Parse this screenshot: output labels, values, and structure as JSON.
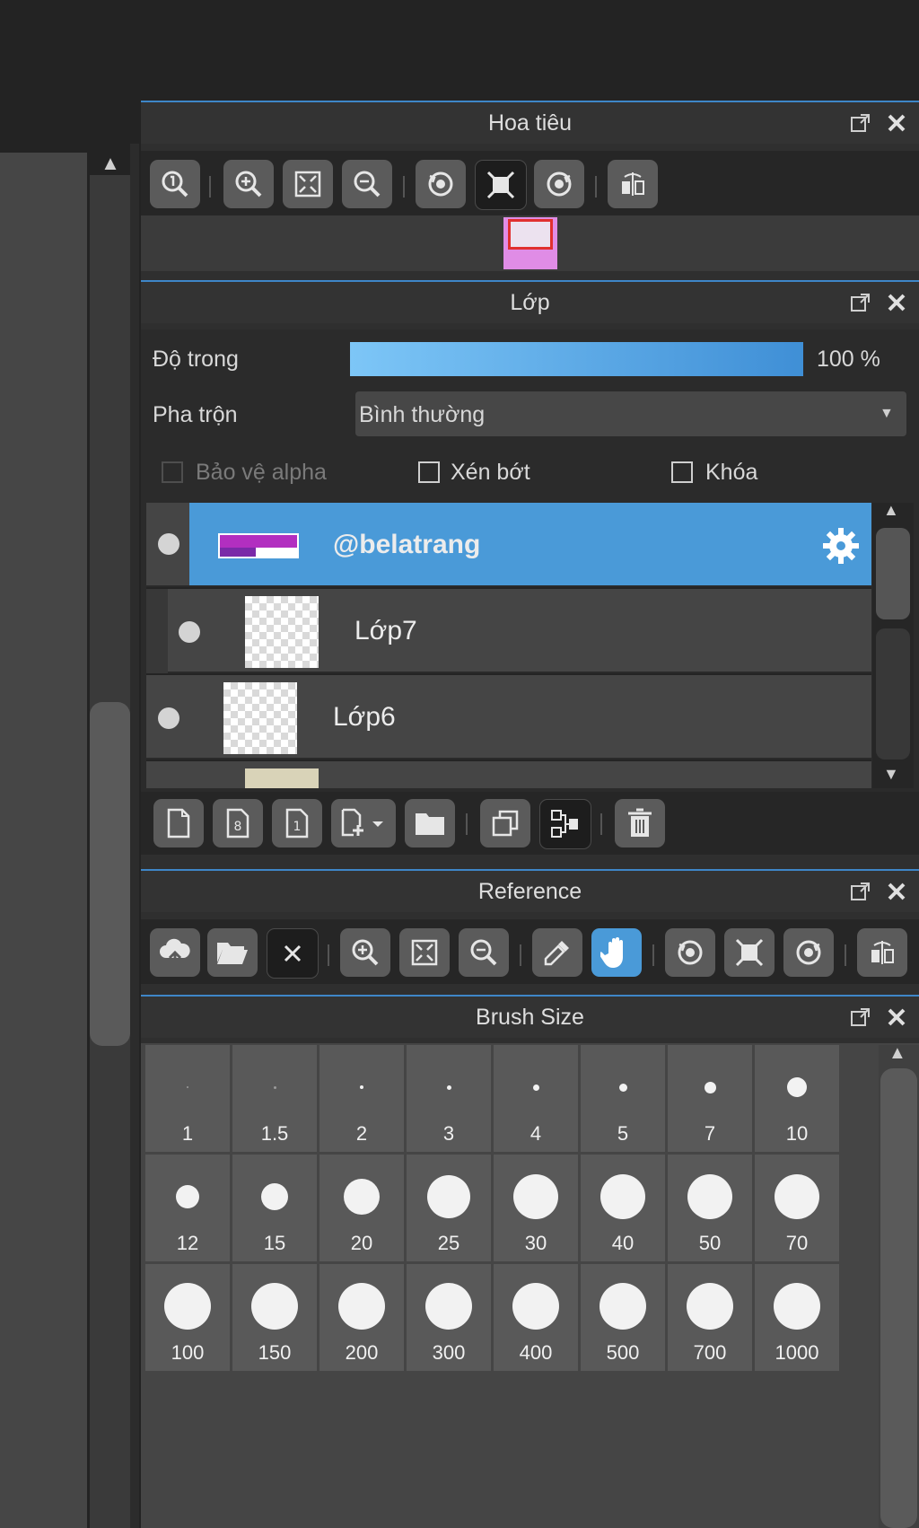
{
  "navigator": {
    "title": "Hoa tiêu",
    "tools": [
      "zoom-actual-icon",
      "zoom-in-icon",
      "fit-screen-icon",
      "zoom-out-icon",
      "rotate-left-icon",
      "reset-rotation-icon",
      "rotate-right-icon",
      "flip-horizontal-icon"
    ]
  },
  "layer_panel": {
    "title": "Lớp",
    "opacity_label": "Độ trong",
    "opacity_value": "100 %",
    "opacity_fraction": 1.0,
    "blend_label": "Pha trộn",
    "blend_value": "Bình thường",
    "protect_alpha_label": "Bảo vệ alpha",
    "clipping_label": "Xén bớt",
    "lock_label": "Khóa",
    "layers": [
      {
        "name": "@belatrang",
        "selected": true
      },
      {
        "name": "Lớp7",
        "selected": false
      },
      {
        "name": "Lớp6",
        "selected": false
      }
    ]
  },
  "reference": {
    "title": "Reference"
  },
  "brush_size": {
    "title": "Brush Size",
    "sizes": [
      "1",
      "1.5",
      "2",
      "3",
      "4",
      "5",
      "7",
      "10",
      "12",
      "15",
      "20",
      "25",
      "30",
      "40",
      "50",
      "70",
      "100",
      "150",
      "200",
      "300",
      "400",
      "500",
      "700",
      "1000"
    ]
  },
  "colors": {
    "accent": "#4a9ad8",
    "panel_border": "#3e86c8",
    "background": "#232323"
  }
}
